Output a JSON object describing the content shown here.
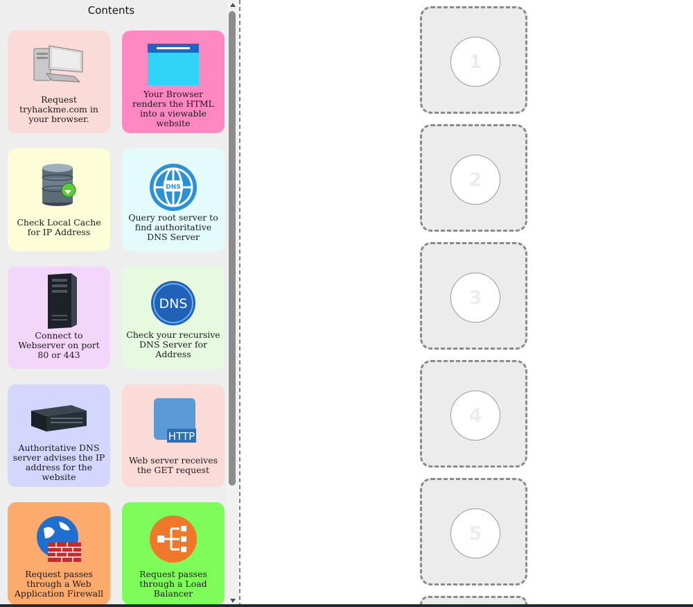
{
  "sidebar": {
    "title": "Contents",
    "cards": [
      {
        "label": "Request tryhackme.com in your browser.",
        "color": "#fadbd8",
        "icon": "computer-icon"
      },
      {
        "label": "Your Browser renders the HTML into a viewable website",
        "color": "#ff88c2",
        "icon": "browser-window-icon"
      },
      {
        "label": "Check Local Cache for IP Address",
        "color": "#fdfdd8",
        "icon": "database-icon"
      },
      {
        "label": "Query root server to find authoritative DNS Server",
        "color": "#e3fbfb",
        "icon": "dns-globe-icon"
      },
      {
        "label": "Connect to Webserver on port 80 or 443",
        "color": "#f4d6fb",
        "icon": "server-tower-icon"
      },
      {
        "label": "Check your recursive DNS Server for Address",
        "color": "#e6fadf",
        "icon": "dns-icon"
      },
      {
        "label": "Authoritative DNS server advises the IP address for the website",
        "color": "#d4d6fd",
        "icon": "rack-server-icon"
      },
      {
        "label": "Web server receives the GET request",
        "color": "#fadbd8",
        "icon": "http-icon"
      },
      {
        "label": "Request passes through a Web Application Firewall",
        "color": "#fdaa6d",
        "icon": "firewall-globe-icon"
      },
      {
        "label": "Request passes through a Load Balancer",
        "color": "#7efc5a",
        "icon": "load-balancer-icon"
      }
    ]
  },
  "icons": {
    "http_text": "HTTP",
    "dns_text": "DNS",
    "dns_small_text": "DNS"
  },
  "slots": [
    "1",
    "2",
    "3",
    "4",
    "5"
  ]
}
